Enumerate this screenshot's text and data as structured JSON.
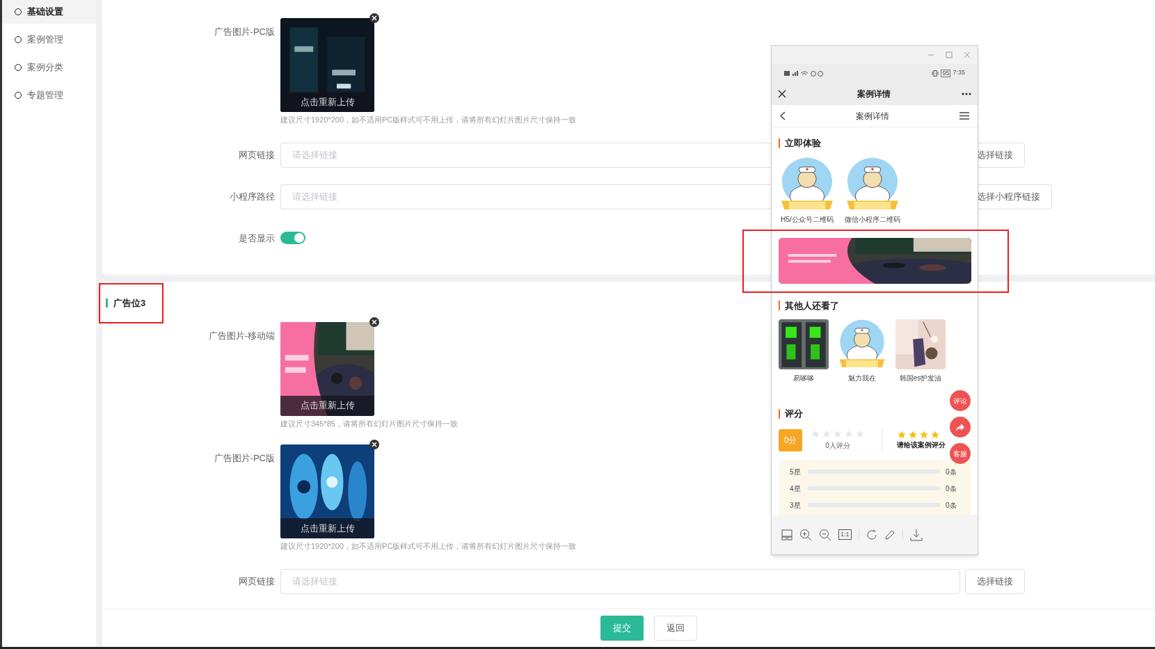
{
  "sidebar": {
    "items": [
      {
        "label": "基础设置",
        "selected": true
      },
      {
        "label": "案例管理",
        "selected": false
      },
      {
        "label": "案例分类",
        "selected": false
      },
      {
        "label": "专题管理",
        "selected": false
      }
    ]
  },
  "sections": [
    {
      "fields": [
        {
          "label": "广告图片-PC版",
          "upload_text": "点击重新上传",
          "hint": "建议尺寸1920*200，如不适用PC版样式可不用上传，请将所有幻灯片图片尺寸保持一致"
        },
        {
          "kind": "link",
          "label": "网页链接",
          "placeholder": "请选择链接",
          "button": "选择链接"
        },
        {
          "kind": "link",
          "label": "小程序路径",
          "placeholder": "请选择链接",
          "button": "选择小程序链接"
        },
        {
          "kind": "switch",
          "label": "是否显示",
          "on": true
        }
      ]
    },
    {
      "title": "广告位3",
      "highlighted": true,
      "fields": [
        {
          "label": "广告图片-移动端",
          "upload_text": "点击重新上传",
          "hint": "建议尺寸345*85，请将所有幻灯片图片尺寸保持一致"
        },
        {
          "label": "广告图片-PC版",
          "upload_text": "点击重新上传",
          "hint": "建议尺寸1920*200，如不适用PC版样式可不用上传，请将所有幻灯片图片尺寸保持一致"
        },
        {
          "kind": "link",
          "label": "网页链接",
          "placeholder": "请选择链接",
          "button": "选择链接"
        }
      ]
    }
  ],
  "footer": {
    "buttons": [
      {
        "label": "提交",
        "kind": "primary"
      },
      {
        "label": "返回",
        "kind": "default"
      }
    ]
  },
  "phone": {
    "status_bar": {
      "battery": "95",
      "time": "7:35"
    },
    "title": "案例详情",
    "nav_title": "案例详情",
    "experience": {
      "title": "立即体验",
      "codes": [
        {
          "caption": "H5/公众号二维码"
        },
        {
          "caption": "微信小程序二维码"
        }
      ]
    },
    "banner": {
      "highlighted": true
    },
    "others": {
      "title": "其他人还看了",
      "items": [
        {
          "caption": "易哆哆"
        },
        {
          "caption": "魅力我在"
        },
        {
          "caption": "韩国es护发油"
        }
      ]
    },
    "rating": {
      "title": "评分",
      "score": "0分",
      "stars": 0,
      "count": "0人评分",
      "prompt": {
        "text": "请给该案例评分",
        "stars": 4
      },
      "breakdown": [
        {
          "label": "5星",
          "level": 0,
          "count": "0条"
        },
        {
          "label": "4星",
          "level": 0,
          "count": "0条"
        },
        {
          "label": "3星",
          "level": 0,
          "count": "0条"
        }
      ]
    },
    "float_buttons": [
      {
        "kind": "text",
        "label": "评论"
      },
      {
        "kind": "share"
      },
      {
        "kind": "text",
        "label": "客服"
      }
    ],
    "toolbar": {
      "actual_size_label": "1:1"
    }
  }
}
